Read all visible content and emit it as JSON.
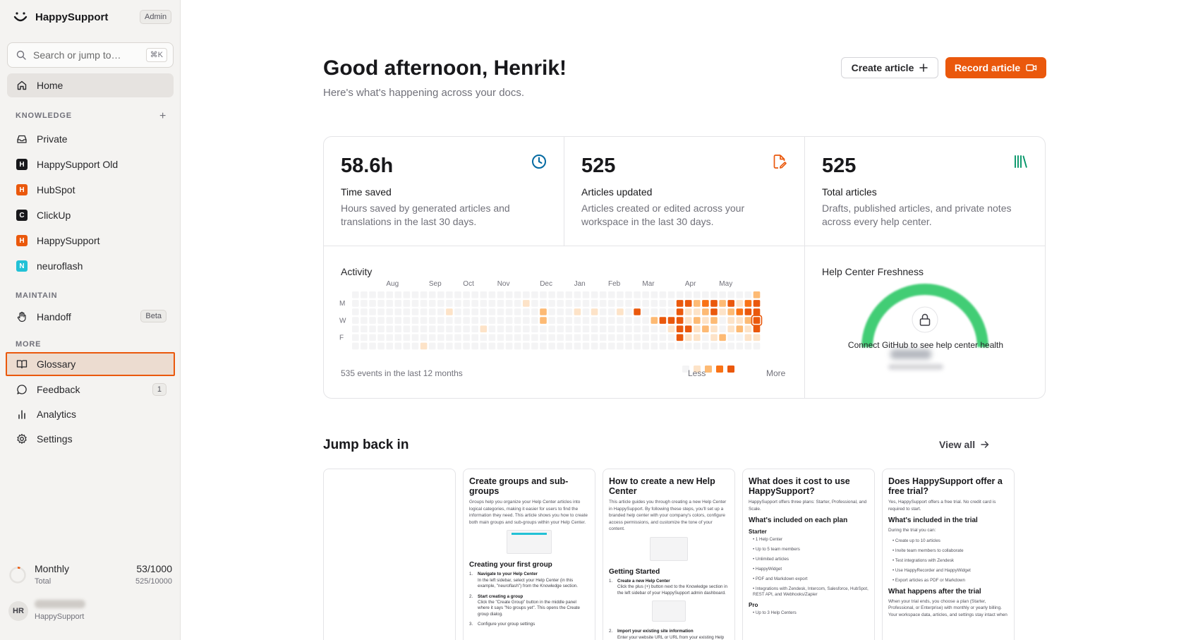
{
  "brand": {
    "name": "HappySupport",
    "role_badge": "Admin"
  },
  "search": {
    "placeholder": "Search or jump to…",
    "shortcut": "⌘K"
  },
  "nav": {
    "home": "Home",
    "knowledge_label": "KNOWLEDGE",
    "knowledge_add": "+",
    "workspaces": [
      {
        "label": "Private",
        "icon": "inbox-icon"
      },
      {
        "label": "HappySupport Old",
        "initial": "H",
        "color": "#18181b"
      },
      {
        "label": "HubSpot",
        "initial": "H",
        "color": "#ea580c"
      },
      {
        "label": "ClickUp",
        "initial": "C",
        "color": "#18181b"
      },
      {
        "label": "HappySupport",
        "initial": "H",
        "color": "#ea580c"
      },
      {
        "label": "neuroflash",
        "initial": "N",
        "color": "#22c1d6"
      }
    ],
    "maintain_label": "MAINTAIN",
    "handoff": {
      "label": "Handoff",
      "badge": "Beta"
    },
    "more_label": "MORE",
    "glossary": "Glossary",
    "feedback": {
      "label": "Feedback",
      "count": "1"
    },
    "analytics": "Analytics",
    "settings": "Settings"
  },
  "usage": {
    "title": "Monthly",
    "subtitle": "Total",
    "monthly": "53/1000",
    "total": "525/10000"
  },
  "user": {
    "initials": "HR",
    "org": "HappySupport"
  },
  "header": {
    "greeting": "Good afternoon, Henrik!",
    "subtitle": "Here's what's happening across your docs."
  },
  "actions": {
    "create": "Create article",
    "record": "Record article"
  },
  "stats": [
    {
      "value": "58.6h",
      "label": "Time saved",
      "desc": "Hours saved by generated articles and translations in the last 30 days.",
      "icon": "clock-icon",
      "color": "#0369a1"
    },
    {
      "value": "525",
      "label": "Articles updated",
      "desc": "Articles created or edited across your workspace in the last 30 days.",
      "icon": "file-edit-icon",
      "color": "#ea580c"
    },
    {
      "value": "525",
      "label": "Total articles",
      "desc": "Drafts, published articles, and private notes across every help center.",
      "icon": "library-icon",
      "color": "#059669"
    }
  ],
  "activity": {
    "title": "Activity",
    "months": [
      "Aug",
      "Sep",
      "Oct",
      "Nov",
      "Dec",
      "Jan",
      "Feb",
      "Mar",
      "Apr",
      "May"
    ],
    "day_labels": [
      "M",
      "W",
      "F"
    ],
    "summary": "535 events in the last 12 months",
    "legend_less": "Less",
    "legend_more": "More",
    "colors": [
      "#f4f4f5",
      "#fde3c8",
      "#fdba74",
      "#f97316",
      "#ea580c"
    ],
    "cells": [
      [
        47,
        1,
        4
      ],
      [
        47,
        2,
        4
      ],
      [
        47,
        3,
        4
      ],
      [
        47,
        4,
        4
      ],
      [
        47,
        0,
        2
      ],
      [
        47,
        5,
        1
      ],
      [
        47,
        6,
        0
      ],
      [
        46,
        1,
        3
      ],
      [
        46,
        2,
        4
      ],
      [
        46,
        3,
        2
      ],
      [
        46,
        4,
        1
      ],
      [
        46,
        5,
        1
      ],
      [
        46,
        0,
        0
      ],
      [
        46,
        6,
        0
      ],
      [
        45,
        1,
        1
      ],
      [
        45,
        2,
        3
      ],
      [
        45,
        3,
        1
      ],
      [
        45,
        4,
        2
      ],
      [
        45,
        0,
        0
      ],
      [
        45,
        5,
        0
      ],
      [
        45,
        6,
        0
      ],
      [
        44,
        1,
        4
      ],
      [
        44,
        2,
        2
      ],
      [
        44,
        3,
        1
      ],
      [
        44,
        4,
        1
      ],
      [
        44,
        5,
        0
      ],
      [
        44,
        0,
        0
      ],
      [
        44,
        6,
        0
      ],
      [
        43,
        1,
        2
      ],
      [
        43,
        2,
        1
      ],
      [
        43,
        3,
        0
      ],
      [
        43,
        4,
        0
      ],
      [
        43,
        5,
        2
      ],
      [
        43,
        0,
        0
      ],
      [
        43,
        6,
        0
      ],
      [
        42,
        1,
        4
      ],
      [
        42,
        2,
        4
      ],
      [
        42,
        3,
        2
      ],
      [
        42,
        4,
        1
      ],
      [
        42,
        5,
        1
      ],
      [
        42,
        0,
        0
      ],
      [
        42,
        6,
        0
      ],
      [
        41,
        1,
        3
      ],
      [
        41,
        2,
        2
      ],
      [
        41,
        3,
        1
      ],
      [
        41,
        4,
        2
      ],
      [
        41,
        5,
        0
      ],
      [
        41,
        0,
        0
      ],
      [
        41,
        6,
        0
      ],
      [
        40,
        1,
        2
      ],
      [
        40,
        2,
        1
      ],
      [
        40,
        3,
        2
      ],
      [
        40,
        4,
        1
      ],
      [
        40,
        5,
        1
      ],
      [
        40,
        0,
        0
      ],
      [
        40,
        6,
        0
      ],
      [
        39,
        1,
        4
      ],
      [
        39,
        2,
        1
      ],
      [
        39,
        3,
        1
      ],
      [
        39,
        4,
        4
      ],
      [
        39,
        5,
        1
      ],
      [
        39,
        0,
        0
      ],
      [
        39,
        6,
        0
      ],
      [
        38,
        1,
        4
      ],
      [
        38,
        2,
        4
      ],
      [
        38,
        3,
        4
      ],
      [
        38,
        4,
        4
      ],
      [
        38,
        5,
        4
      ],
      [
        38,
        0,
        0
      ],
      [
        38,
        6,
        0
      ],
      [
        37,
        1,
        0
      ],
      [
        37,
        2,
        0
      ],
      [
        37,
        3,
        4
      ],
      [
        37,
        4,
        1
      ],
      [
        37,
        0,
        0
      ],
      [
        37,
        5,
        0
      ],
      [
        37,
        6,
        0
      ],
      [
        36,
        1,
        0
      ],
      [
        36,
        2,
        0
      ],
      [
        36,
        3,
        4
      ],
      [
        36,
        4,
        0
      ],
      [
        36,
        0,
        0
      ],
      [
        36,
        5,
        0
      ],
      [
        36,
        6,
        0
      ],
      [
        35,
        1,
        0
      ],
      [
        35,
        2,
        0
      ],
      [
        35,
        3,
        2
      ],
      [
        35,
        4,
        0
      ],
      [
        35,
        0,
        0
      ],
      [
        35,
        5,
        0
      ],
      [
        35,
        6,
        0
      ],
      [
        33,
        2,
        4
      ],
      [
        33,
        3,
        0
      ],
      [
        31,
        2,
        1
      ],
      [
        28,
        2,
        1
      ],
      [
        26,
        2,
        1
      ],
      [
        22,
        2,
        2
      ],
      [
        22,
        3,
        2
      ],
      [
        20,
        1,
        1
      ],
      [
        20,
        2,
        0
      ],
      [
        15,
        4,
        1
      ],
      [
        11,
        2,
        1
      ],
      [
        8,
        6,
        1
      ],
      [
        6,
        2,
        0
      ]
    ]
  },
  "freshness": {
    "title": "Help Center Freshness",
    "message": "Connect GitHub to see help center health",
    "ring_color": "#22c55e"
  },
  "jump": {
    "title": "Jump back in",
    "view_all": "View all"
  },
  "articles": [
    {},
    {
      "title": "Create groups and sub-groups",
      "intro": "Groups help you organize your Help Center articles into logical categories, making it easier for users to find the information they need. This article shows you how to create both main groups and sub-groups within your Help Center.",
      "h2": "Creating your first group",
      "steps": [
        {
          "t": "Navigate to your Help Center",
          "d": "In the left sidebar, select your Help Center (in this example, \"neuroflash\") from the Knowledge section."
        },
        {
          "t": "Start creating a group",
          "d": "Click the \"Create Group\" button in the middle panel where it says \"No groups yet\". This opens the Create group dialog."
        },
        {
          "t": "Configure your group settings",
          "d": ""
        }
      ]
    },
    {
      "title": "How to create a new Help Center",
      "intro": "This article guides you through creating a new Help Center in HappySupport. By following these steps, you'll set up a branded help center with your company's colors, configure access permissions, and customize the tone of your content.",
      "h2": "Getting Started",
      "steps": [
        {
          "t": "Create a new Help Center",
          "d": "Click the plus (+) button next to the Knowledge section in the left sidebar of your HappySupport admin dashboard."
        },
        {
          "t": "Import your existing site information",
          "d": "Enter your website URL or URL from your existing Help"
        }
      ]
    },
    {
      "title": "What does it cost to use HappySupport?",
      "intro": "HappySupport offers three plans: Starter, Professional, and Scale.",
      "h2": "What's included on each plan",
      "h3": "Starter",
      "bullets": [
        "1 Help Center",
        "Up to 5 team members",
        "Unlimited articles",
        "HappyWidget",
        "PDF and Markdown export",
        "Integrations with Zendesk, Intercom, Salesforce, HubSpot, REST API, and Webhooks/Zapier"
      ],
      "h3b": "Pro",
      "bullets2": [
        "Up to 3 Help Centers"
      ]
    },
    {
      "title": "Does HappySupport offer a free trial?",
      "intro": "Yes, HappySupport offers a free trial. No credit card is required to start.",
      "h2": "What's included in the trial",
      "lead": "During the trial you can:",
      "bullets": [
        "Create up to 10 articles",
        "Invite team members to collaborate",
        "Test integrations with Zendesk",
        "Use HappyRecorder and HappyWidget",
        "Export articles as PDF or Markdown"
      ],
      "h2b": "What happens after the trial",
      "outro": "When your trial ends, you choose a plan (Starter, Professional, or Enterprise) with monthly or yearly billing. Your workspace data, articles, and settings stay intact when"
    }
  ]
}
